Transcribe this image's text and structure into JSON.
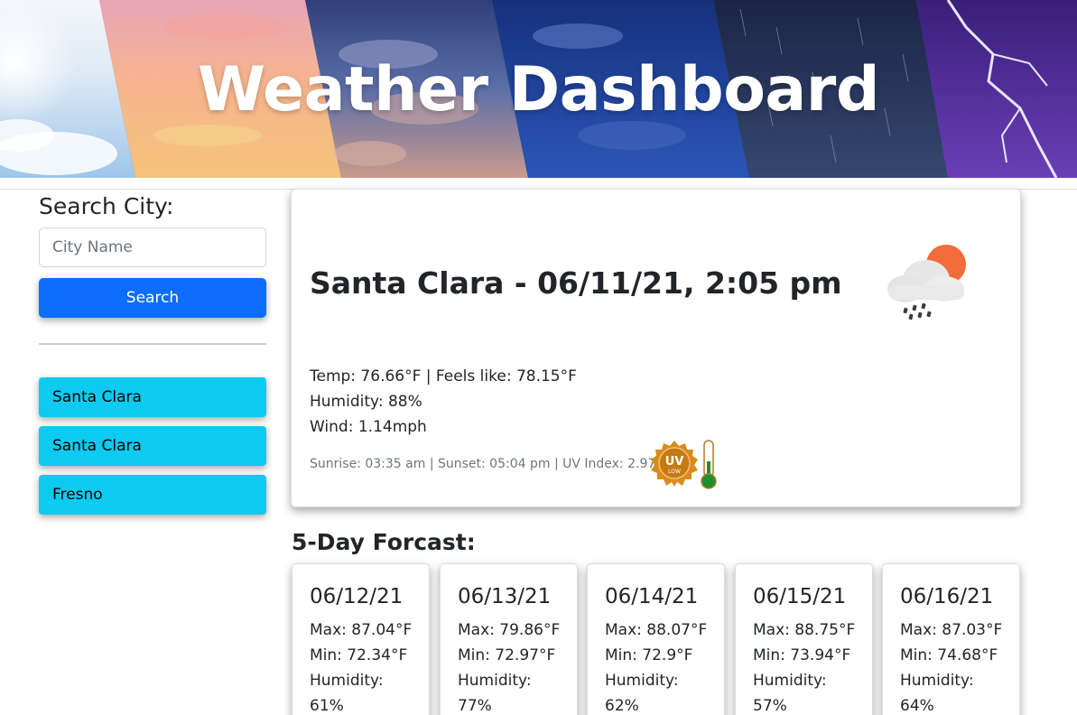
{
  "header": {
    "title": "Weather Dashboard"
  },
  "search": {
    "heading": "Search City:",
    "placeholder": "City Name",
    "button_label": "Search"
  },
  "history": [
    "Santa Clara",
    "Santa Clara",
    "Fresno"
  ],
  "current": {
    "title": "Santa Clara - 06/11/21, 2:05 pm",
    "temp_line": "Temp: 76.66°F | Feels like: 78.15°F",
    "humidity_line": "Humidity: 88%",
    "wind_line": "Wind: 1.14mph",
    "sun_line": "Sunrise: 03:35 am | Sunset: 05:04 pm | UV Index: 2.97",
    "weather_icon": "cloud-sun-rain-icon",
    "uv_badge": {
      "text": "UV",
      "level": "LOW",
      "color": "#d98a1c"
    },
    "thermometer_icon": "thermometer-icon"
  },
  "forecast": {
    "heading": "5-Day Forcast:",
    "days": [
      {
        "date": "06/12/21",
        "max": "Max: 87.04°F",
        "min": "Min: 72.34°F",
        "hum_label": "Humidity:",
        "hum_value": "61%"
      },
      {
        "date": "06/13/21",
        "max": "Max: 79.86°F",
        "min": "Min: 72.97°F",
        "hum_label": "Humidity:",
        "hum_value": "77%"
      },
      {
        "date": "06/14/21",
        "max": "Max: 88.07°F",
        "min": "Min: 72.9°F",
        "hum_label": "Humidity:",
        "hum_value": "62%"
      },
      {
        "date": "06/15/21",
        "max": "Max: 88.75°F",
        "min": "Min: 73.94°F",
        "hum_label": "Humidity:",
        "hum_value": "57%"
      },
      {
        "date": "06/16/21",
        "max": "Max: 87.03°F",
        "min": "Min: 74.68°F",
        "hum_label": "Humidity:",
        "hum_value": "64%"
      }
    ]
  },
  "colors": {
    "primary": "#0d6efd",
    "history_button": "#0dcaf0",
    "sun": "#f26b3a",
    "uv_low_badge": "#d98a1c",
    "thermometer_fill": "#1e8f2e"
  }
}
